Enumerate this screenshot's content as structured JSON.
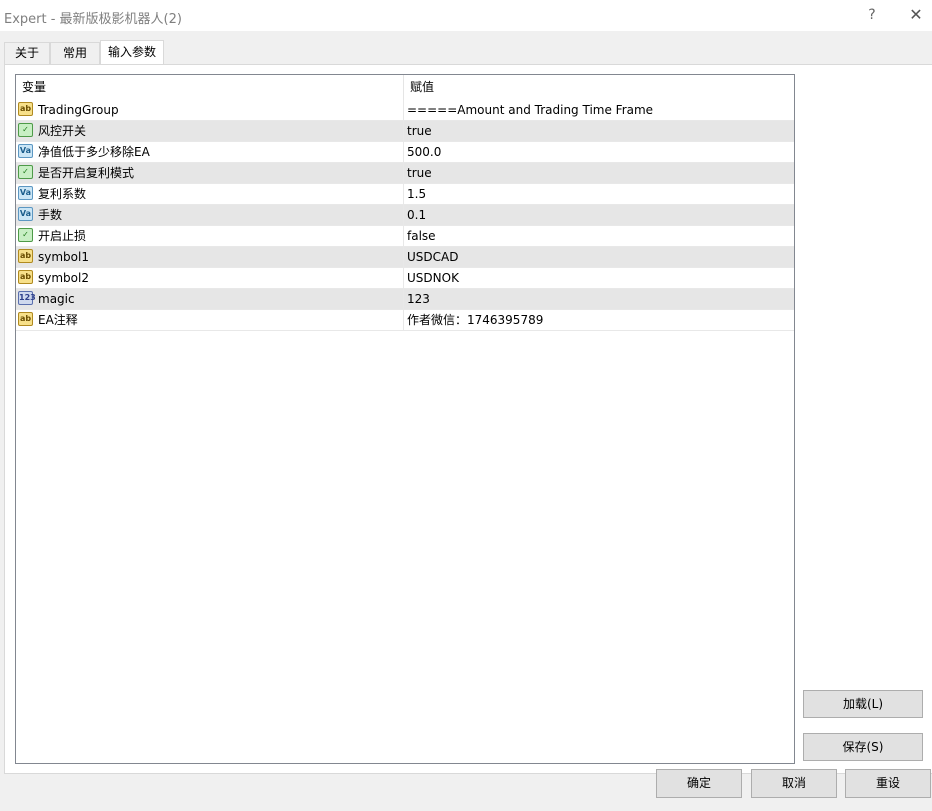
{
  "window": {
    "title": "Expert - 最新版极影机器人(2)",
    "help": "?",
    "close": "✕"
  },
  "tabs": [
    {
      "label": "关于"
    },
    {
      "label": "常用"
    },
    {
      "label": "输入参数"
    }
  ],
  "grid": {
    "columns": [
      "变量",
      "赋值"
    ],
    "rows": [
      {
        "icon": "ab",
        "name": "TradingGroup",
        "value": "=====Amount and Trading Time Frame"
      },
      {
        "icon": "bool",
        "name": "风控开关",
        "value": "true"
      },
      {
        "icon": "dbl",
        "name": "净值低于多少移除EA",
        "value": "500.0"
      },
      {
        "icon": "bool",
        "name": "是否开启复利模式",
        "value": "true"
      },
      {
        "icon": "dbl",
        "name": "复利系数",
        "value": "1.5"
      },
      {
        "icon": "dbl",
        "name": "手数",
        "value": "0.1"
      },
      {
        "icon": "bool",
        "name": "开启止损",
        "value": "false"
      },
      {
        "icon": "ab",
        "name": "symbol1",
        "value": "USDCAD"
      },
      {
        "icon": "ab",
        "name": "symbol2",
        "value": "USDNOK"
      },
      {
        "icon": "int",
        "name": "magic",
        "value": "123"
      },
      {
        "icon": "ab",
        "name": "EA注释",
        "value": "作者微信：1746395789"
      }
    ]
  },
  "icons": {
    "ab": "ab",
    "bool": "✓",
    "dbl": "Va",
    "int": "123"
  },
  "buttons": {
    "load": "加载(L)",
    "save": "保存(S)",
    "ok": "确定",
    "cancel": "取消",
    "reset": "重设"
  }
}
